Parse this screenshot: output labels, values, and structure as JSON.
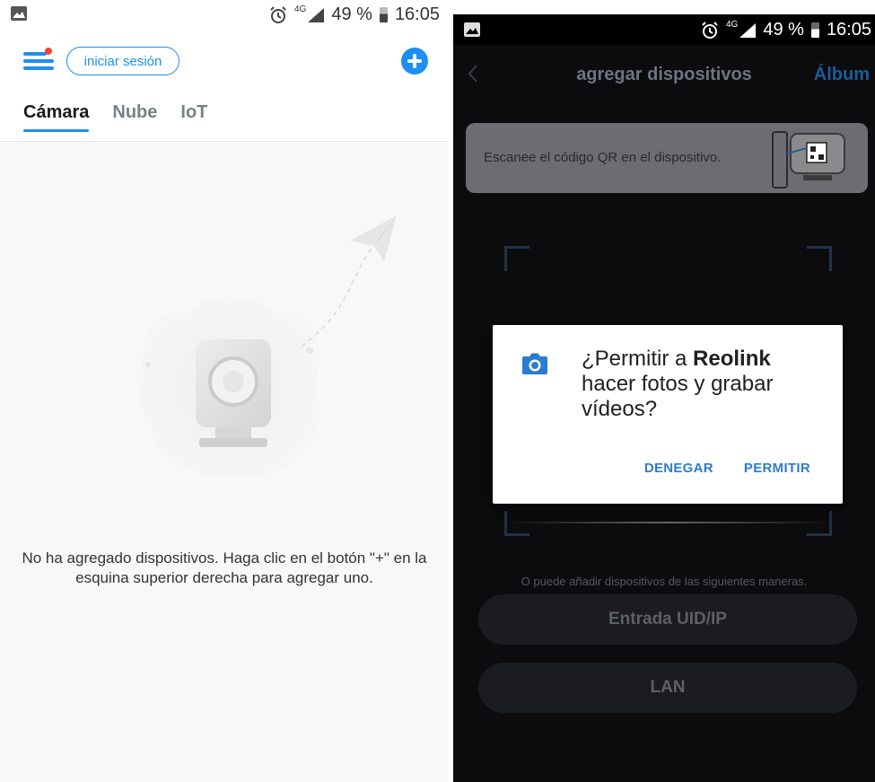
{
  "left_screen": {
    "status_bar": {
      "time": "16:05",
      "battery": "49 %",
      "network": "4G"
    },
    "header": {
      "login_label": "iniciar sesión"
    },
    "tabs": [
      {
        "label": "Cámara",
        "active": true
      },
      {
        "label": "Nube",
        "active": false
      },
      {
        "label": "IoT",
        "active": false
      }
    ],
    "empty_message": "No ha agregado dispositivos. Haga clic en el botón \"+\" en la esquina superior derecha para agregar uno."
  },
  "right_screen": {
    "status_bar": {
      "time": "16:05",
      "battery": "49 %",
      "network": "4G"
    },
    "nav": {
      "title": "agregar dispositivos",
      "album_label": "Álbum"
    },
    "qr_banner": {
      "text": "Escanee el código QR en el dispositivo."
    },
    "alternative_text": "O puede añadir dispositivos de las siguientes maneras.",
    "buttons": {
      "uid_ip": "Entrada UID/IP",
      "lan": "LAN"
    },
    "permission_dialog": {
      "prefix": "¿Permitir a ",
      "app_name": "Reolink",
      "suffix": " hacer fotos y grabar vídeos?",
      "deny_label": "DENEGAR",
      "allow_label": "PERMITIR"
    }
  },
  "colors": {
    "accent": "#1d8ff2",
    "dialog_button": "#2b7cd3",
    "dark_background": "#0c0c0e"
  },
  "icons": {
    "menu": "menu-icon",
    "add": "plus-circle-icon",
    "back": "chevron-left-icon",
    "camera": "camera-icon",
    "alarm": "alarm-icon",
    "image": "image-icon"
  }
}
